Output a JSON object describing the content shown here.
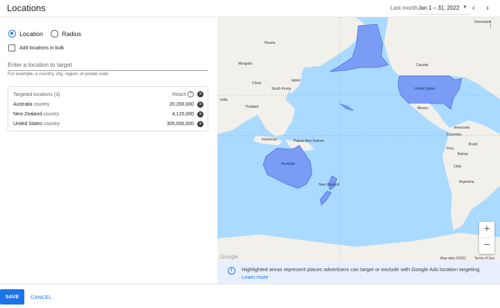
{
  "header": {
    "title": "Locations",
    "date_label": "Last month",
    "date_range": "Jan 1 – 31, 2022"
  },
  "location_type": {
    "location_label": "Location",
    "radius_label": "Radius",
    "selected": "Location"
  },
  "bulk": {
    "label": "Add locations in bulk",
    "checked": false
  },
  "search": {
    "placeholder": "Enter a location to target",
    "hint": "For example, a country, city, region, or postal code"
  },
  "targets": {
    "header": "Targeted locations (3)",
    "reach_header": "Reach",
    "rows": [
      {
        "name": "Australia",
        "type": "country",
        "reach": "20,200,000"
      },
      {
        "name": "New Zealand",
        "type": "country",
        "reach": "4,120,000"
      },
      {
        "name": "United States",
        "type": "country",
        "reach": "305,000,000"
      }
    ]
  },
  "map": {
    "labels": {
      "greenland": "Greenland",
      "russia": "Russia",
      "mongolia": "Mongolia",
      "china": "China",
      "south_korea": "South Korea",
      "japan": "Japan",
      "india": "India",
      "thailand": "Thailand",
      "indonesia": "Indonesia",
      "papua_new_guinea": "Papua New Guinea",
      "australia": "Australia",
      "new_zealand": "New Zealand",
      "canada": "Canada",
      "united_states": "United States",
      "mexico": "Mexico",
      "venezuela": "Venezuela",
      "colombia": "Colombia",
      "peru": "Peru",
      "bolivia": "Bolivia",
      "brazil": "Brazil",
      "chile": "Chile",
      "argentina": "Argentina",
      "google": "Google"
    },
    "attribution": "Map data ©2022",
    "terms": "Terms of Use",
    "zoom_in": "+",
    "zoom_out": "−",
    "highlight_color": "#7b9cf5"
  },
  "info": {
    "text": "Highlighted areas represent places advertisers can target or exclude with Google Ads location targeting.",
    "link": "Learn more"
  },
  "footer": {
    "save": "SAVE",
    "cancel": "CANCEL"
  },
  "colors": {
    "accent": "#1a73e8",
    "water": "#aadaff",
    "land": "#f2f0ea"
  }
}
